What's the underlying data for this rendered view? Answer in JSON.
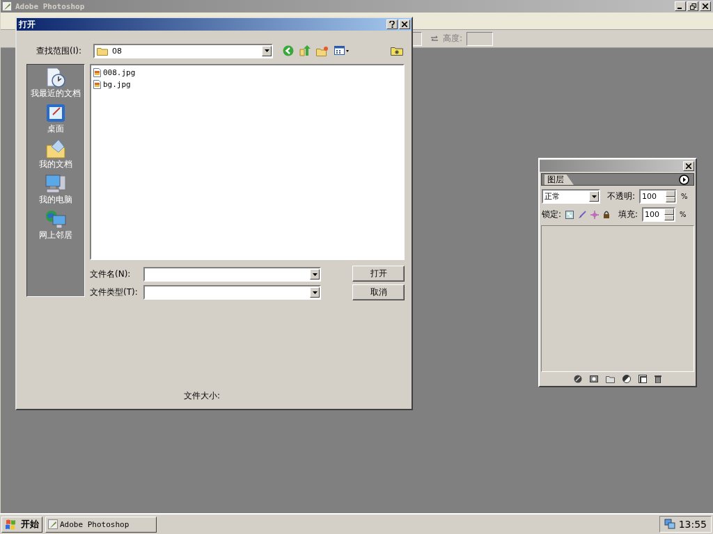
{
  "app": {
    "title": "Adobe Photoshop",
    "height_label": "高度:"
  },
  "dialog": {
    "title": "打开",
    "lookin_label": "查找范围(I):",
    "folder": "08",
    "places": [
      {
        "label": "我最近的文档",
        "kind": "recent"
      },
      {
        "label": "桌面",
        "kind": "desktop"
      },
      {
        "label": "我的文档",
        "kind": "documents"
      },
      {
        "label": "我的电脑",
        "kind": "computer"
      },
      {
        "label": "网上邻居",
        "kind": "network"
      }
    ],
    "files": [
      {
        "name": "008.jpg",
        "selected": false
      },
      {
        "name": "bg.jpg",
        "selected": false
      }
    ],
    "filename_label": "文件名(N):",
    "filetype_label": "文件类型(T):",
    "buttons": [
      "打开",
      "取消"
    ],
    "filesize_label": "文件大小:"
  },
  "layers": {
    "tabs": [
      {
        "label": "图层",
        "selected": true
      }
    ],
    "blend_mode": "正常",
    "opacity_label": "不透明:",
    "opacity": "100",
    "opacity_unit": "%",
    "lock_label": "锁定:",
    "fill_label": "填充:",
    "fill": "100",
    "fill_unit": "%"
  },
  "taskbar": {
    "start": "开始",
    "tasks": [
      {
        "label": "Adobe Photoshop",
        "selected": false
      }
    ],
    "clock": "13:55"
  }
}
